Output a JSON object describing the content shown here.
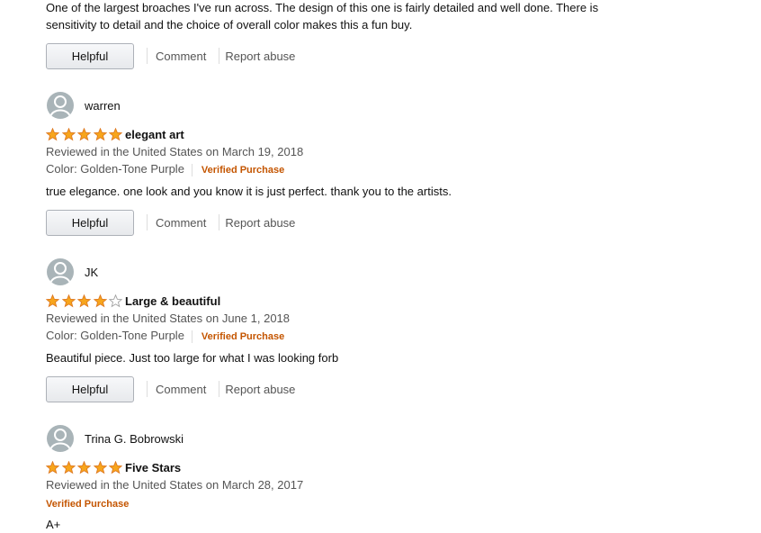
{
  "partial_review": {
    "body": "One of the largest broaches I've run across. The design of this one is fairly detailed and well done. There is sensitivity to detail and the choice of overall color makes this a fun buy."
  },
  "actions": {
    "helpful": "Helpful",
    "comment": "Comment",
    "report": "Report abuse"
  },
  "reviews": [
    {
      "author": "warren",
      "rating": 5,
      "title": "elegant art",
      "date_line": "Reviewed in the United States on March 19, 2018",
      "color": "Color: Golden-Tone Purple",
      "verified": "Verified Purchase",
      "body": "true elegance. one look and you know it is just perfect. thank you to the artists."
    },
    {
      "author": "JK",
      "rating": 4,
      "title": "Large & beautiful",
      "date_line": "Reviewed in the United States on June 1, 2018",
      "color": "Color: Golden-Tone Purple",
      "verified": "Verified Purchase",
      "body": "Beautiful piece. Just too large for what I was looking forb"
    },
    {
      "author": "Trina G. Bobrowski",
      "rating": 5,
      "title": "Five Stars",
      "date_line": "Reviewed in the United States on March 28, 2017",
      "verified": "Verified Purchase",
      "body": "A+"
    }
  ],
  "colors": {
    "star_fill": "#f7a51c",
    "verified": "#c45500",
    "muted_text": "#555555"
  }
}
